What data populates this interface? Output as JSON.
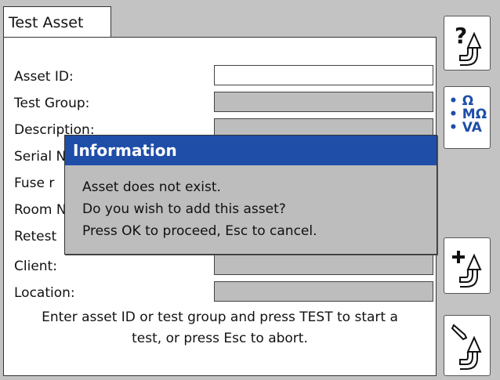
{
  "tab": {
    "label": "Test Asset"
  },
  "form": {
    "fields": [
      {
        "label": "Asset ID:"
      },
      {
        "label": "Test Group:"
      },
      {
        "label": "Description:"
      },
      {
        "label": "Serial N"
      },
      {
        "label": "Fuse r"
      },
      {
        "label": "Room N"
      },
      {
        "label": "Retest"
      },
      {
        "label": "Client:"
      },
      {
        "label": "Location:"
      }
    ],
    "hint_line1": "Enter asset ID or test group and press TEST to start a",
    "hint_line2": "test, or press Esc to abort."
  },
  "sidebar": {
    "help_icon": "question-plug-icon",
    "units": [
      "Ω",
      "MΩ",
      "VA"
    ],
    "add_icon": "plus-plug-icon",
    "edit_icon": "pencil-plug-icon"
  },
  "dialog": {
    "title": "Information",
    "line1": "Asset does not exist.",
    "line2": "Do you wish to add this asset?",
    "line3": "Press OK to proceed, Esc to cancel.",
    "title_color": "#1f4ea8"
  }
}
